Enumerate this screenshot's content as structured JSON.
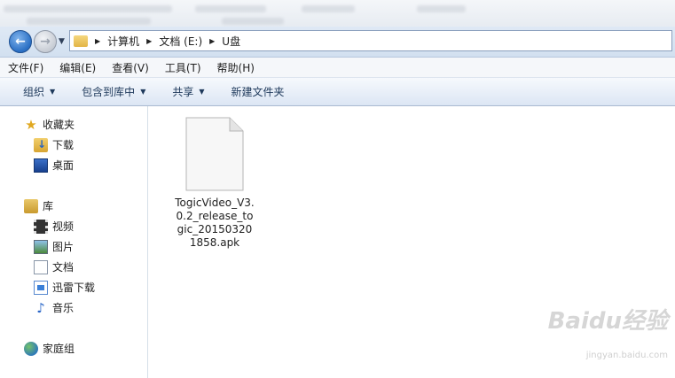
{
  "address": {
    "crumbs": [
      "计算机",
      "文档 (E:)",
      "U盘"
    ]
  },
  "menu": [
    "文件(F)",
    "编辑(E)",
    "查看(V)",
    "工具(T)",
    "帮助(H)"
  ],
  "commands": {
    "organize": "组织",
    "include_library": "包含到库中",
    "share": "共享",
    "new_folder": "新建文件夹"
  },
  "nav": {
    "favorites": "收藏夹",
    "downloads": "下载",
    "desktop": "桌面",
    "libraries": "库",
    "videos": "视频",
    "pictures": "图片",
    "documents": "文档",
    "xunlei": "迅雷下载",
    "music": "音乐",
    "homegroup": "家庭组"
  },
  "files": [
    {
      "name": "TogicVideo_V3.0.2_release_togic_201503201858.apk"
    }
  ],
  "watermark": {
    "logo": "Baidu经验",
    "url": "jingyan.baidu.com"
  }
}
